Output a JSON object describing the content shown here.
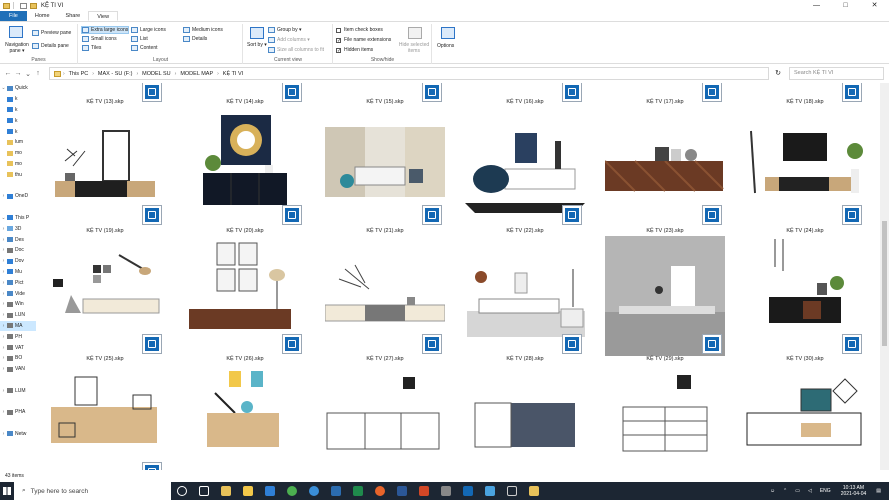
{
  "window": {
    "title": "KỆ TI VI",
    "minimize": "—",
    "maximize": "□",
    "close": "✕"
  },
  "tabs": [
    {
      "label": "File"
    },
    {
      "label": "Home"
    },
    {
      "label": "Share"
    },
    {
      "label": "View"
    }
  ],
  "ribbon": {
    "panes": {
      "navigation_pane": "Navigation pane ▾",
      "preview_pane": "Preview pane",
      "details_pane": "Details pane",
      "label": "Panes"
    },
    "layout": {
      "extra_large": "Extra large icons",
      "large": "Large icons",
      "medium": "Medium icons",
      "small": "Small icons",
      "list": "List",
      "details": "Details",
      "tiles": "Tiles",
      "content": "Content",
      "label": "Layout"
    },
    "current_view": {
      "sort_by": "Sort by ▾",
      "group_by": "Group by ▾",
      "add_columns": "Add columns ▾",
      "size_columns": "Size all columns to fit",
      "label": "Current view"
    },
    "show_hide": {
      "item_checkboxes": "Item check boxes",
      "file_ext": "File name extensions",
      "hidden_items": "Hidden items",
      "hide_selected": "Hide selected items",
      "label": "Show/hide",
      "item_checkboxes_checked": false,
      "file_ext_checked": true,
      "hidden_items_checked": true
    },
    "options": {
      "label": "Options"
    }
  },
  "address": {
    "crumbs": [
      "This PC",
      "MAX - SU (F:)",
      "MODEL SU",
      "MODEL MAP",
      "KỆ TI VI"
    ],
    "search_placeholder": "Search KỆ TI VI"
  },
  "nav": {
    "items": [
      {
        "label": "Quick",
        "ex": "⌄"
      },
      {
        "label": "k",
        "ex": ""
      },
      {
        "label": "k",
        "ex": ""
      },
      {
        "label": "k",
        "ex": ""
      },
      {
        "label": "k",
        "ex": ""
      },
      {
        "label": "lum",
        "ex": ""
      },
      {
        "label": "mo",
        "ex": ""
      },
      {
        "label": "mo",
        "ex": ""
      },
      {
        "label": "thu",
        "ex": ""
      },
      {
        "label": "",
        "ex": ""
      },
      {
        "label": "OneD",
        "ex": "›"
      },
      {
        "label": "",
        "ex": ""
      },
      {
        "label": "This P",
        "ex": "⌄"
      },
      {
        "label": "3D",
        "ex": "›"
      },
      {
        "label": "Des",
        "ex": "›"
      },
      {
        "label": "Doc",
        "ex": "›"
      },
      {
        "label": "Dov",
        "ex": "›"
      },
      {
        "label": "Mu",
        "ex": "›"
      },
      {
        "label": "Pict",
        "ex": "›"
      },
      {
        "label": "Vide",
        "ex": "›"
      },
      {
        "label": "Win",
        "ex": "›"
      },
      {
        "label": "LUN",
        "ex": "›"
      },
      {
        "label": "MA",
        "ex": "›",
        "selected": true
      },
      {
        "label": "PH",
        "ex": "›"
      },
      {
        "label": "VAT",
        "ex": "›"
      },
      {
        "label": "BO",
        "ex": "›"
      },
      {
        "label": "VAN",
        "ex": "›"
      },
      {
        "label": "",
        "ex": ""
      },
      {
        "label": "LUM",
        "ex": "›"
      },
      {
        "label": "",
        "ex": ""
      },
      {
        "label": "PHA",
        "ex": "›"
      },
      {
        "label": "",
        "ex": ""
      },
      {
        "label": "Netw",
        "ex": "›"
      }
    ]
  },
  "files_row0": [
    "KỆ TV (13).skp",
    "KỆ TV (14).skp",
    "KỆ TV (15).skp",
    "KỆ TV (16).skp",
    "KỆ TV (17).skp",
    "KỆ TV (18).skp"
  ],
  "files_row1": [
    "KỆ TV (19).skp",
    "KỆ TV (20).skp",
    "KỆ TV (21).skp",
    "KỆ TV (22).skp",
    "KỆ TV (23).skp",
    "KỆ TV (24).skp"
  ],
  "files_row2": [
    "KỆ TV (25).skp",
    "KỆ TV (26).skp",
    "KỆ TV (27).skp",
    "KỆ TV (28).skp",
    "KỆ TV (29).skp",
    "KỆ TV (30).skp"
  ],
  "status": {
    "count": "43 items"
  },
  "taskbar": {
    "search": "Type here to search",
    "time": "10:13 AM",
    "date": "2021-04-04",
    "lang": "ENG"
  }
}
